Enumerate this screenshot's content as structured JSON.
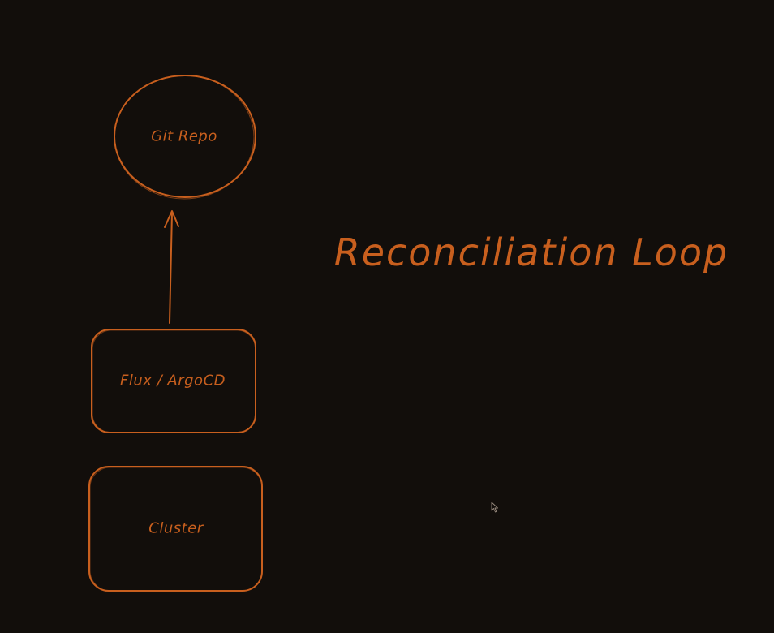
{
  "colors": {
    "background": "#120e0b",
    "stroke": "#c85f1e"
  },
  "diagram": {
    "title": "Reconciliation Loop",
    "nodes": {
      "git_repo": "Git Repo",
      "flux_argocd": "Flux / ArgoCD",
      "cluster": "Cluster"
    }
  },
  "cursor": {
    "icon": "mouse-pointer-icon"
  }
}
